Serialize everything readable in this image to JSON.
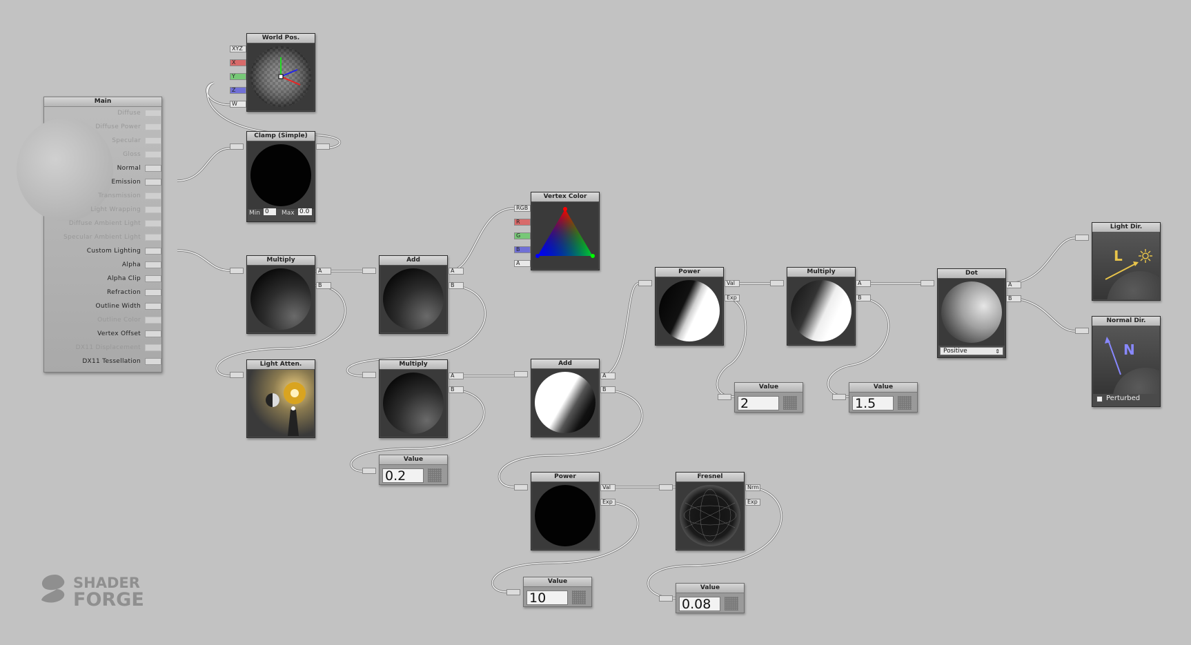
{
  "main": {
    "title": "Main",
    "inputs": [
      {
        "label": "Diffuse",
        "enabled": false
      },
      {
        "label": "Diffuse Power",
        "enabled": false
      },
      {
        "label": "Specular",
        "enabled": false
      },
      {
        "label": "Gloss",
        "enabled": false
      },
      {
        "label": "Normal",
        "enabled": true
      },
      {
        "label": "Emission",
        "enabled": true
      },
      {
        "label": "Transmission",
        "enabled": false
      },
      {
        "label": "Light Wrapping",
        "enabled": false
      },
      {
        "label": "Diffuse Ambient Light",
        "enabled": false
      },
      {
        "label": "Specular Ambient Light",
        "enabled": false
      },
      {
        "label": "Custom Lighting",
        "enabled": true
      },
      {
        "label": "Alpha",
        "enabled": true
      },
      {
        "label": "Alpha Clip",
        "enabled": true
      },
      {
        "label": "Refraction",
        "enabled": true
      },
      {
        "label": "Outline Width",
        "enabled": true
      },
      {
        "label": "Outline Color",
        "enabled": false
      },
      {
        "label": "Vertex Offset",
        "enabled": true
      },
      {
        "label": "DX11 Displacement",
        "enabled": false
      },
      {
        "label": "DX11 Tessellation",
        "enabled": true
      }
    ]
  },
  "nodes": {
    "world_pos": {
      "title": "World Pos.",
      "outputs": [
        "XYZ",
        "X",
        "Y",
        "Z",
        "W"
      ]
    },
    "clamp": {
      "title": "Clamp (Simple)",
      "min_label": "Min",
      "min_value": "0",
      "max_label": "Max",
      "max_value": "0.0"
    },
    "multiply1": {
      "title": "Multiply",
      "outputs": [
        "A",
        "B"
      ]
    },
    "light_atten": {
      "title": "Light Atten."
    },
    "add1": {
      "title": "Add",
      "outputs": [
        "A",
        "B"
      ]
    },
    "multiply2": {
      "title": "Multiply",
      "outputs": [
        "A",
        "B"
      ]
    },
    "value_02": {
      "title": "Value",
      "value": "0.2"
    },
    "vertex_color": {
      "title": "Vertex Color",
      "outputs": [
        "RGB",
        "R",
        "G",
        "B",
        "A"
      ]
    },
    "add2": {
      "title": "Add",
      "outputs": [
        "A",
        "B"
      ]
    },
    "power1": {
      "title": "Power",
      "outputs": [
        "Val",
        "Exp"
      ]
    },
    "value_10": {
      "title": "Value",
      "value": "10"
    },
    "fresnel": {
      "title": "Fresnel",
      "outputs": [
        "Nrm",
        "Exp"
      ]
    },
    "value_008": {
      "title": "Value",
      "value": "0.08"
    },
    "power2": {
      "title": "Power",
      "outputs": [
        "Val",
        "Exp"
      ]
    },
    "value_2": {
      "title": "Value",
      "value": "2"
    },
    "multiply3": {
      "title": "Multiply",
      "outputs": [
        "A",
        "B"
      ]
    },
    "value_15": {
      "title": "Value",
      "value": "1.5"
    },
    "dot": {
      "title": "Dot",
      "outputs": [
        "A",
        "B"
      ],
      "mode": "Positive"
    },
    "light_dir": {
      "title": "Light Dir.",
      "glyph": "L"
    },
    "normal_dir": {
      "title": "Normal Dir.",
      "glyph": "N",
      "checkbox_label": "Perturbed"
    }
  },
  "logo": {
    "line1": "SHADER",
    "line2": "FORGE"
  },
  "colors": {
    "canvas": "#c2c2c2",
    "node_body": "#4a4a4a",
    "wire": "#f0f0f0",
    "port_r": "#d86a6a",
    "port_g": "#77c877",
    "port_b": "#7070d6",
    "light_glyph": "#e8c44a",
    "normal_glyph": "#8888ff"
  }
}
